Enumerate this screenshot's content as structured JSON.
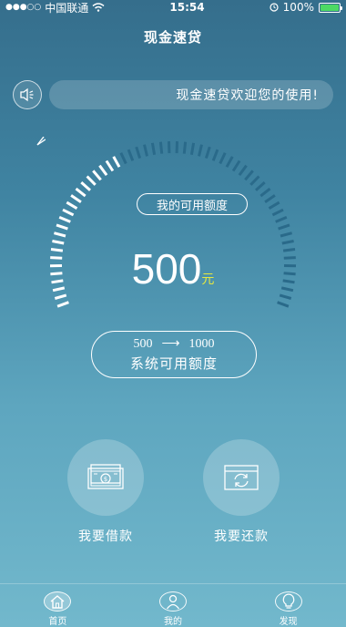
{
  "status_bar": {
    "carrier": "中国联通",
    "time": "15:54",
    "battery": "100%"
  },
  "header": {
    "title": "现金速贷"
  },
  "announcement": {
    "text": "现金速贷欢迎您的使用!"
  },
  "credit": {
    "bubble_label": "我的可用额度",
    "amount": "500",
    "unit": "元",
    "range_from": "500",
    "range_to": "1000",
    "range_label": "系统可用额度"
  },
  "actions": {
    "borrow_label": "我要借款",
    "repay_label": "我要还款"
  },
  "tabs": [
    {
      "label": "首页",
      "icon": "home-icon"
    },
    {
      "label": "我的",
      "icon": "user-icon"
    },
    {
      "label": "发现",
      "icon": "bulb-icon"
    }
  ],
  "colors": {
    "accent_yellow": "#e6e840",
    "battery_green": "#4cd964"
  }
}
